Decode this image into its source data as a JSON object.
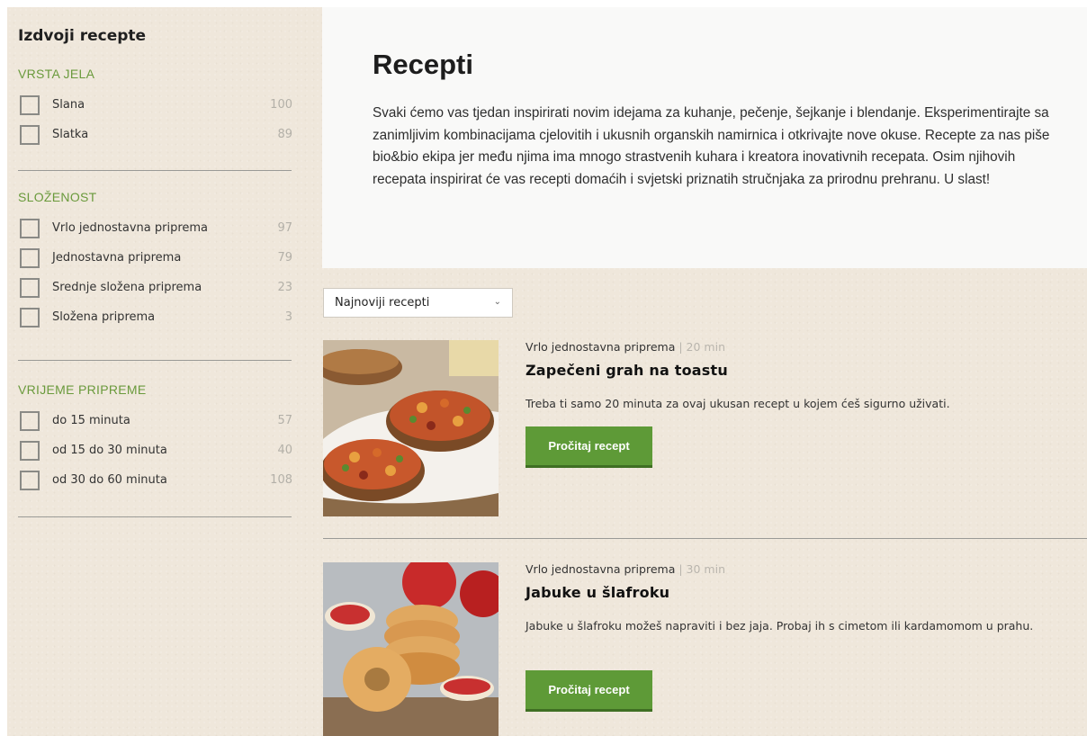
{
  "sidebar": {
    "title": "Izdvoji recepte",
    "groups": [
      {
        "title": "VRSTA JELA",
        "options": [
          {
            "label": "Slana",
            "count": "100"
          },
          {
            "label": "Slatka",
            "count": "89"
          }
        ]
      },
      {
        "title": "SLOŽENOST",
        "options": [
          {
            "label": "Vrlo jednostavna priprema",
            "count": "97"
          },
          {
            "label": "Jednostavna priprema",
            "count": "79"
          },
          {
            "label": "Srednje složena priprema",
            "count": "23"
          },
          {
            "label": "Složena priprema",
            "count": "3"
          }
        ]
      },
      {
        "title": "VRIJEME PRIPREME",
        "options": [
          {
            "label": "do 15 minuta",
            "count": "57"
          },
          {
            "label": "od 15 do 30 minuta",
            "count": "40"
          },
          {
            "label": "od 30 do 60 minuta",
            "count": "108"
          }
        ]
      }
    ]
  },
  "intro": {
    "title": "Recepti",
    "text": "Svaki ćemo vas tjedan inspirirati novim idejama za kuhanje, pečenje, šejkanje i blendanje. Eksperimentirajte sa zanimljivim kombinacijama cjelovitih i ukusnih organskih namirnica i otkrivajte nove okuse. Recepte za nas piše bio&bio ekipa jer među njima ima mnogo strastvenih kuhara i kreatora inovativnih recepata. Osim njihovih recepata inspirirat će vas recepti domaćih i svjetski priznatih stručnjaka za prirodnu prehranu. U slast!"
  },
  "sort": {
    "selected": "Najnoviji recepti"
  },
  "recipes": [
    {
      "difficulty": "Vrlo jednostavna priprema",
      "separator": "|",
      "time": "20 min",
      "title": "Zapečeni grah na toastu",
      "description": "Treba ti samo 20 minuta za ovaj ukusan recept u kojem ćeš sigurno uživati.",
      "button": "Pročitaj recept"
    },
    {
      "difficulty": "Vrlo jednostavna priprema",
      "separator": "|",
      "time": "30 min",
      "title": "Jabuke u šlafroku",
      "description": "Jabuke u šlafroku možeš napraviti i bez jaja. Probaj ih s cimetom ili kardamomom u prahu.",
      "button": "Pročitaj recept"
    }
  ],
  "colors": {
    "accent_green": "#6a9a3c",
    "button_green": "#5e9a37",
    "background": "#efe7db"
  }
}
